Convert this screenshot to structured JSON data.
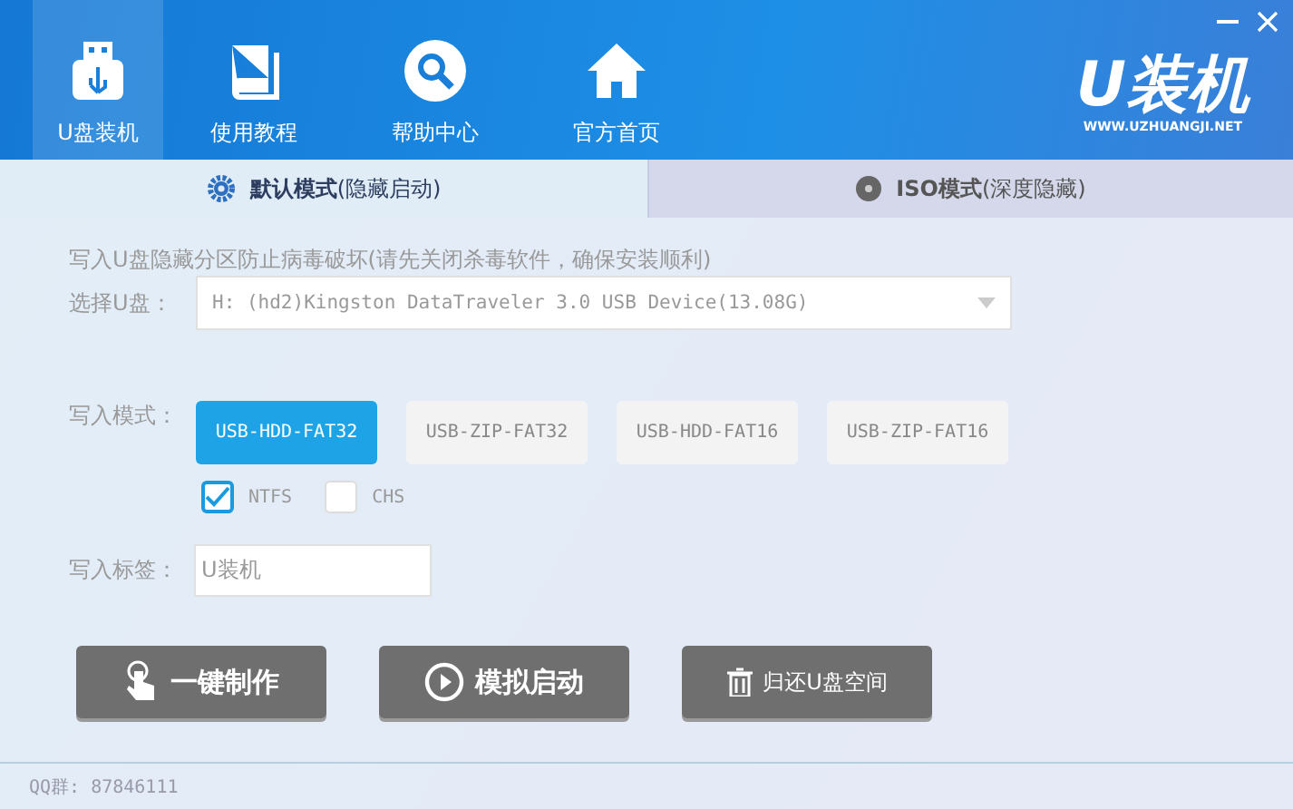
{
  "nav": [
    {
      "label": "U盘装机",
      "kind": "usb",
      "selected": true
    },
    {
      "label": "使用教程",
      "kind": "book",
      "selected": false
    },
    {
      "label": "帮助中心",
      "kind": "search",
      "selected": false
    },
    {
      "label": "官方首页",
      "kind": "home",
      "selected": false
    }
  ],
  "logo": {
    "text": "U装机",
    "url": "WWW.UZHUANGJI.NET"
  },
  "mode_tabs": [
    {
      "label": "**默认模式**(隐藏启动)",
      "kind": "gear",
      "selected": true
    },
    {
      "label": "**ISO模式**(深度隐藏)",
      "kind": "disc",
      "selected": false
    }
  ],
  "hint": "写入U盘隐藏分区防止病毒破坏(请先关闭杀毒软件，确保安装顺利)",
  "disk": {
    "label": "选择U盘：",
    "value": "H: (hd2)Kingston DataTraveler 3.0 USB Device(13.08G)"
  },
  "write_mode": {
    "label": "写入模式：",
    "options": [
      {
        "label": "USB-HDD-FAT32",
        "selected": true
      },
      {
        "label": "USB-ZIP-FAT32",
        "selected": false
      },
      {
        "label": "USB-HDD-FAT16",
        "selected": false
      },
      {
        "label": "USB-ZIP-FAT16",
        "selected": false
      }
    ]
  },
  "checkboxes": [
    {
      "label": "NTFS",
      "checked": true
    },
    {
      "label": "CHS",
      "checked": false
    }
  ],
  "volume_label": {
    "label": "写入标签：",
    "value": "U装机"
  },
  "actions": [
    {
      "label": "一键制作",
      "kind": "hand"
    },
    {
      "label": "模拟启动",
      "kind": "play"
    },
    {
      "label": "归还U盘空间",
      "kind": "trash"
    }
  ],
  "status_bar": "QQ群: 87846111"
}
